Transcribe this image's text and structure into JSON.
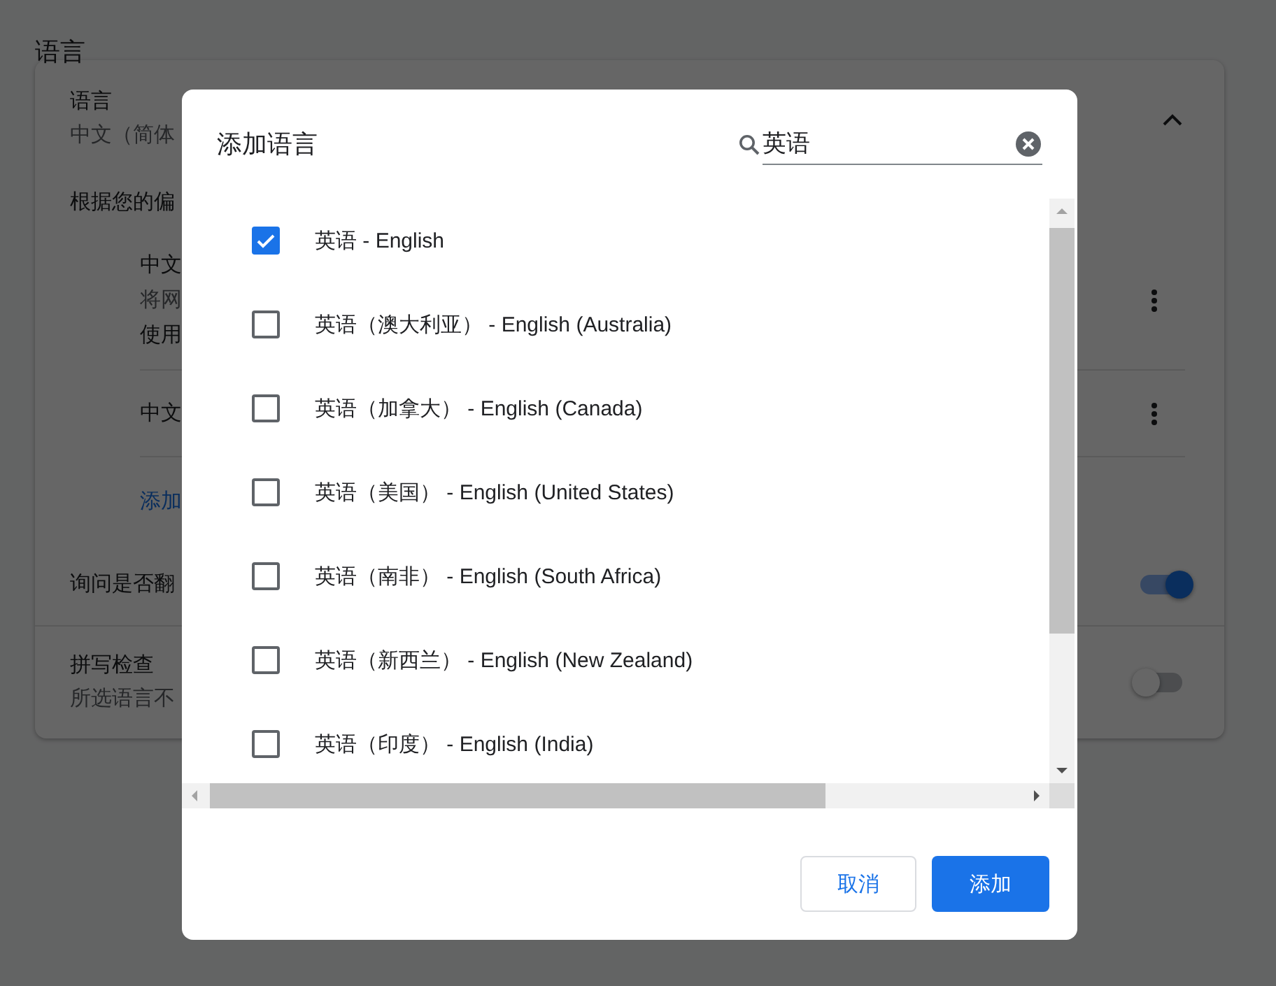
{
  "page_title": "语言",
  "card": {
    "header": {
      "title": "语言",
      "subtitle": "中文（简体",
      "expanded": true
    },
    "preference_label": "根据您的偏",
    "languages": [
      {
        "lines": [
          "中文",
          "将网",
          "使用"
        ]
      },
      {
        "lines": [
          "中文"
        ]
      }
    ],
    "add_link": "添加",
    "translate": {
      "label": "询问是否翻",
      "on": true
    },
    "spellcheck": {
      "title": "拼写检查",
      "subtitle": "所选语言不",
      "on": false
    }
  },
  "dialog": {
    "title": "添加语言",
    "search": {
      "value": "英语"
    },
    "items": [
      {
        "label": "英语 - English",
        "checked": true
      },
      {
        "label": "英语（澳大利亚） - English (Australia)",
        "checked": false
      },
      {
        "label": "英语（加拿大） - English (Canada)",
        "checked": false
      },
      {
        "label": "英语（美国） - English (United States)",
        "checked": false
      },
      {
        "label": "英语（南非） - English (South Africa)",
        "checked": false
      },
      {
        "label": "英语（新西兰） - English (New Zealand)",
        "checked": false
      },
      {
        "label": "英语（印度） - English (India)",
        "checked": false
      }
    ],
    "cancel": "取消",
    "confirm": "添加"
  }
}
